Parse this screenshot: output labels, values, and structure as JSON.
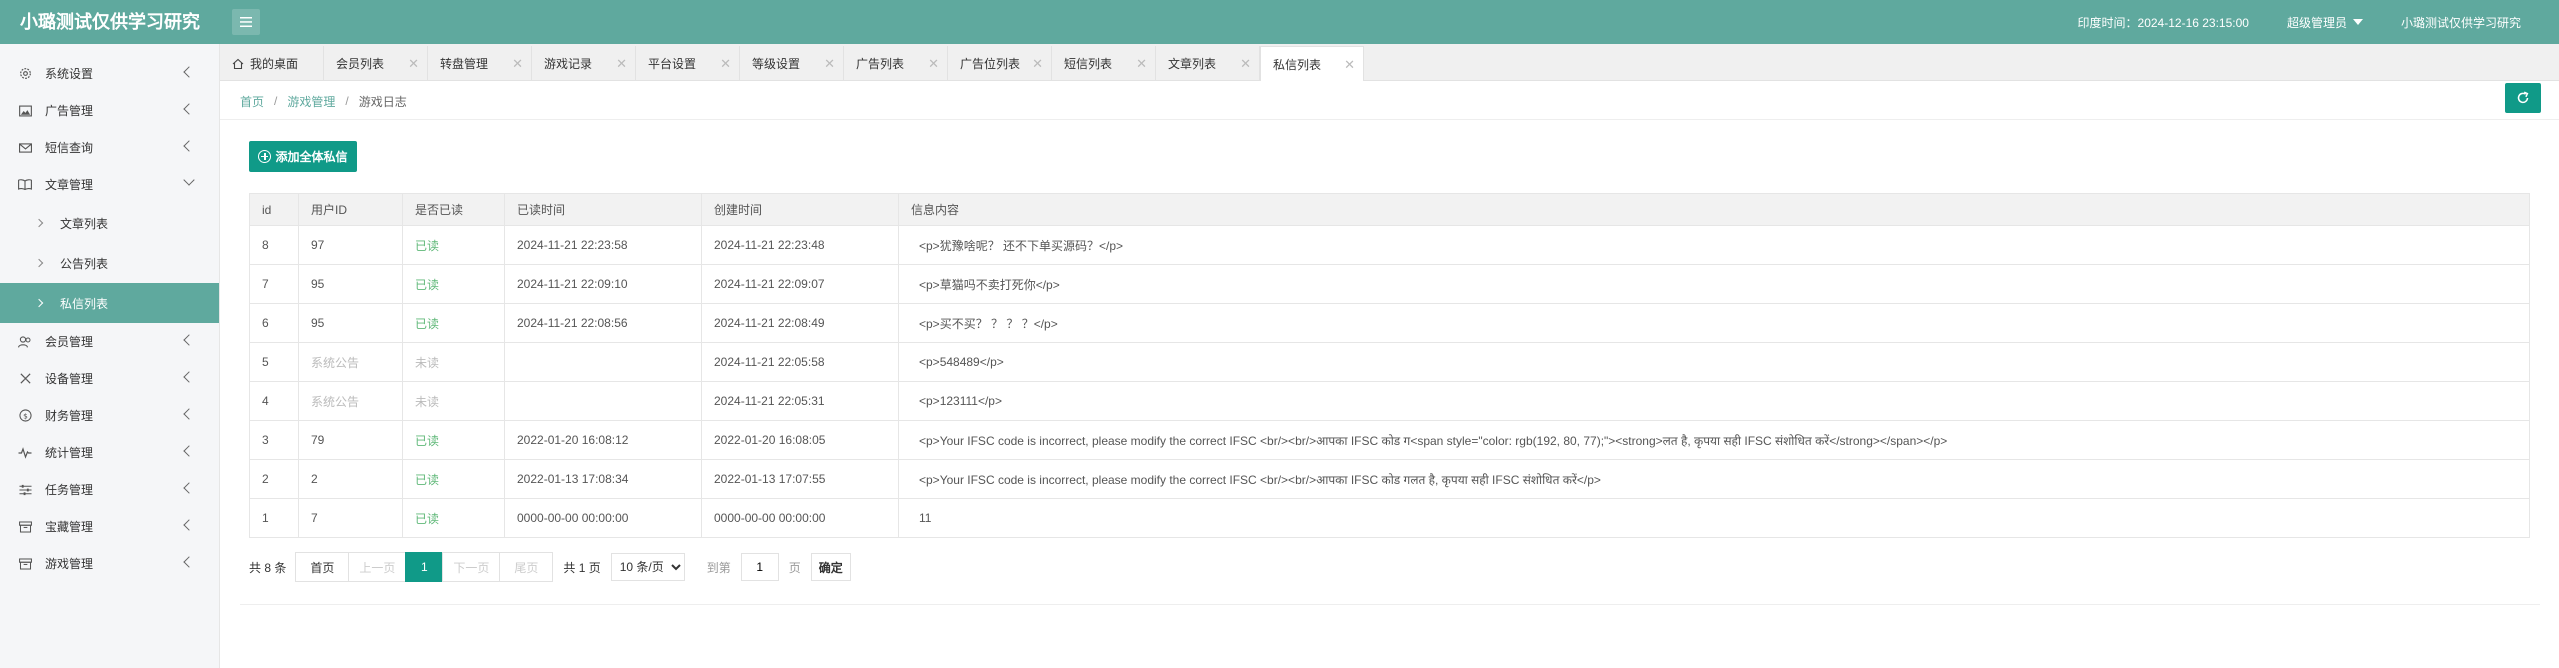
{
  "header": {
    "title": "小璐测试仅供学习研究",
    "time_label": "印度时间：2024-12-16 23:15:00",
    "user_role": "超级管理员",
    "site_name": "小璐测试仅供学习研究",
    "brand_color": "#5fa99e"
  },
  "sidebar": {
    "items": [
      {
        "label": "系统设置",
        "icon": "gear-icon"
      },
      {
        "label": "广告管理",
        "icon": "image-icon"
      },
      {
        "label": "短信查询",
        "icon": "mail-icon"
      },
      {
        "label": "文章管理",
        "icon": "book-icon"
      },
      {
        "label": "会员管理",
        "icon": "users-icon"
      },
      {
        "label": "设备管理",
        "icon": "devices-icon"
      },
      {
        "label": "财务管理",
        "icon": "money-icon"
      },
      {
        "label": "统计管理",
        "icon": "pulse-icon"
      },
      {
        "label": "任务管理",
        "icon": "sliders-icon"
      },
      {
        "label": "宝藏管理",
        "icon": "box-icon"
      },
      {
        "label": "游戏管理",
        "icon": "box-icon"
      }
    ],
    "subitems": [
      {
        "label": "文章列表"
      },
      {
        "label": "公告列表"
      },
      {
        "label": "私信列表"
      }
    ]
  },
  "tabs": [
    {
      "label": "我的桌面"
    },
    {
      "label": "会员列表"
    },
    {
      "label": "转盘管理"
    },
    {
      "label": "游戏记录"
    },
    {
      "label": "平台设置"
    },
    {
      "label": "等级设置"
    },
    {
      "label": "广告列表"
    },
    {
      "label": "广告位列表"
    },
    {
      "label": "短信列表"
    },
    {
      "label": "文章列表"
    },
    {
      "label": "私信列表"
    }
  ],
  "breadcrumb": {
    "home": "首页",
    "section": "游戏管理",
    "current": "游戏日志",
    "sep": "/"
  },
  "actions": {
    "add_label": "添加全体私信"
  },
  "table": {
    "columns": [
      "id",
      "用户ID",
      "是否已读",
      "已读时间",
      "创建时间",
      "信息内容"
    ],
    "rows": [
      {
        "id": "8",
        "user": "97",
        "read": "已读",
        "read_time": "2024-11-21 22:23:58",
        "created": "2024-11-21 22:23:48",
        "content": "<p>犹豫啥呢？ 还不下单买源码？</p>"
      },
      {
        "id": "7",
        "user": "95",
        "read": "已读",
        "read_time": "2024-11-21 22:09:10",
        "created": "2024-11-21 22:09:07",
        "content": "<p>草猫吗不卖打死你</p>"
      },
      {
        "id": "6",
        "user": "95",
        "read": "已读",
        "read_time": "2024-11-21 22:08:56",
        "created": "2024-11-21 22:08:49",
        "content": "<p>买不买？ ？ ？ ？</p>"
      },
      {
        "id": "5",
        "user": "系统公告",
        "read": "未读",
        "read_time": "",
        "created": "2024-11-21 22:05:58",
        "content": "<p>548489</p>"
      },
      {
        "id": "4",
        "user": "系统公告",
        "read": "未读",
        "read_time": "",
        "created": "2024-11-21 22:05:31",
        "content": "<p>123111</p>"
      },
      {
        "id": "3",
        "user": "79",
        "read": "已读",
        "read_time": "2022-01-20 16:08:12",
        "created": "2022-01-20 16:08:05",
        "content": "<p>Your IFSC code is incorrect, please modify the correct IFSC <br/><br/>आपका IFSC कोड ग<span style=\"color: rgb(192, 80, 77);\"><strong>लत है, कृपया सही IFSC संशोधित करें</strong></span></p>"
      },
      {
        "id": "2",
        "user": "2",
        "read": "已读",
        "read_time": "2022-01-13 17:08:34",
        "created": "2022-01-13 17:07:55",
        "content": "<p>Your IFSC code is incorrect, please modify the correct IFSC <br/><br/>आपका IFSC कोड गलत है, कृपया सही IFSC संशोधित करें</p>"
      },
      {
        "id": "1",
        "user": "7",
        "read": "已读",
        "read_time": "0000-00-00 00:00:00",
        "created": "0000-00-00 00:00:00",
        "content": "11"
      }
    ]
  },
  "pager": {
    "total": "共 8 条",
    "first": "首页",
    "prev": "上一页",
    "current": "1",
    "next": "下一页",
    "last": "尾页",
    "pages": "共 1 页",
    "page_size": "10 条/页",
    "goto_prefix": "到第",
    "goto_value": "1",
    "goto_suffix": "页",
    "confirm": "确定"
  }
}
